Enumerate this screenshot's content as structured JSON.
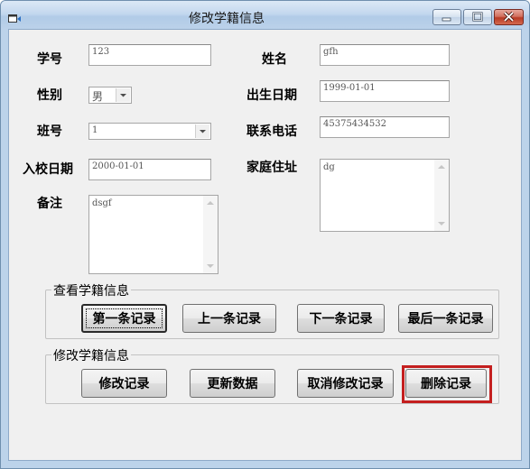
{
  "window": {
    "title": "修改学籍信息",
    "controls": [
      "minimize-icon",
      "maximize-icon",
      "close-icon"
    ]
  },
  "form": {
    "student_id": {
      "label": "学号",
      "value": "123"
    },
    "name": {
      "label": "姓名",
      "value": "gfh"
    },
    "gender": {
      "label": "性别",
      "value": "男"
    },
    "birth_date": {
      "label": "出生日期",
      "value": "1999-01-01"
    },
    "class_no": {
      "label": "班号",
      "value": "1"
    },
    "phone": {
      "label": "联系电话",
      "value": "45375434532"
    },
    "enroll_date": {
      "label": "入校日期",
      "value": "2000-01-01"
    },
    "address": {
      "label": "家庭住址",
      "value": "dg"
    },
    "remarks": {
      "label": "备注",
      "value": "dsgf"
    }
  },
  "view_group": {
    "legend": "查看学籍信息",
    "buttons": [
      "第一条记录",
      "上一条记录",
      "下一条记录",
      "最后一条记录"
    ]
  },
  "edit_group": {
    "legend": "修改学籍信息",
    "buttons": [
      "修改记录",
      "更新数据",
      "取消修改记录",
      "删除记录"
    ]
  },
  "highlight_color": "#c41f1f"
}
